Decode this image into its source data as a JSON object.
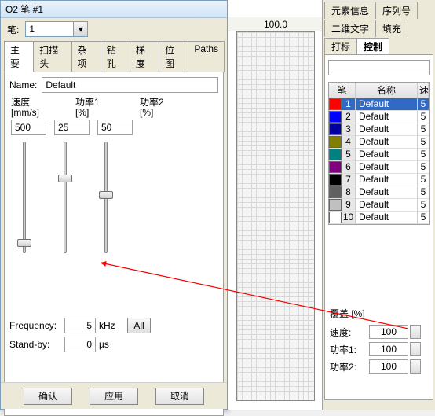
{
  "window": {
    "title": "O2 笔 #1"
  },
  "pen_row": {
    "label": "笔:",
    "selected": "1"
  },
  "tabs": [
    "主要",
    "扫描头",
    "杂项",
    "钻孔",
    "梯度",
    "位图",
    "Paths"
  ],
  "active_tab_index": 0,
  "name": {
    "label": "Name:",
    "value": "Default"
  },
  "columns": {
    "speed": {
      "label": "速度",
      "sub": "[mm/s]",
      "value": "500",
      "slider_pos": 0.88
    },
    "power1": {
      "label": "功率1",
      "sub": "[%]",
      "value": "25",
      "slider_pos": 0.3
    },
    "power2": {
      "label": "功率2",
      "sub": "[%]",
      "value": "50",
      "slider_pos": 0.45
    }
  },
  "frequency": {
    "label": "Frequency:",
    "value": "5",
    "unit": "kHz"
  },
  "standby": {
    "label": "Stand-by:",
    "value": "0",
    "unit": "µs"
  },
  "btn_all": "All",
  "buttons": {
    "ok": "确认",
    "apply": "应用",
    "cancel": "取消"
  },
  "ruler": {
    "tick": "100.0"
  },
  "side_tabs_row1": [
    "元素信息",
    "序列号"
  ],
  "side_tabs_row2": [
    "二维文字",
    "填充"
  ],
  "side_tabs_row3": [
    "打标",
    "控制"
  ],
  "active_side_tab": "控制",
  "pen_table": {
    "headers": {
      "pen": "笔",
      "name": "名称",
      "speed": "速"
    },
    "rows": [
      {
        "n": "1",
        "name": "Default",
        "sp": "5",
        "color": "#ff0000",
        "selected": true
      },
      {
        "n": "2",
        "name": "Default",
        "sp": "5",
        "color": "#0000ff",
        "selected": false
      },
      {
        "n": "3",
        "name": "Default",
        "sp": "5",
        "color": "#0000a0",
        "selected": false
      },
      {
        "n": "4",
        "name": "Default",
        "sp": "5",
        "color": "#808000",
        "selected": false
      },
      {
        "n": "5",
        "name": "Default",
        "sp": "5",
        "color": "#008080",
        "selected": false
      },
      {
        "n": "6",
        "name": "Default",
        "sp": "5",
        "color": "#800080",
        "selected": false
      },
      {
        "n": "7",
        "name": "Default",
        "sp": "5",
        "color": "#000000",
        "selected": false
      },
      {
        "n": "8",
        "name": "Default",
        "sp": "5",
        "color": "#606060",
        "selected": false
      },
      {
        "n": "9",
        "name": "Default",
        "sp": "5",
        "color": "#c0c0c0",
        "selected": false
      },
      {
        "n": "10",
        "name": "Default",
        "sp": "5",
        "color": "#ffffff",
        "selected": false
      }
    ]
  },
  "override": {
    "title": "覆盖 [%]",
    "rows": {
      "speed": {
        "label": "速度:",
        "value": "100"
      },
      "power1": {
        "label": "功率1:",
        "value": "100"
      },
      "power2": {
        "label": "功率2:",
        "value": "100"
      }
    }
  }
}
